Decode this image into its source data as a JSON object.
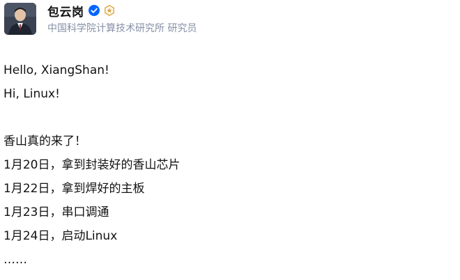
{
  "author": {
    "name": "包云岗",
    "title": "中国科学院计算技术研究所 研究员"
  },
  "post": {
    "greeting_1": "Hello, XiangShan!",
    "greeting_2": "Hi, Linux!",
    "headline": "香山真的来了！",
    "timeline": [
      "1月20日，拿到封装好的香山芯片",
      "1月22日，拿到焊好的主板",
      "1月23日，串口调通",
      "1月24日，启动Linux"
    ],
    "ellipsis": "……"
  },
  "colors": {
    "text": "#121212",
    "muted": "#8590a6",
    "verified": "#0066ff",
    "honor_badge": "#d9a441"
  }
}
